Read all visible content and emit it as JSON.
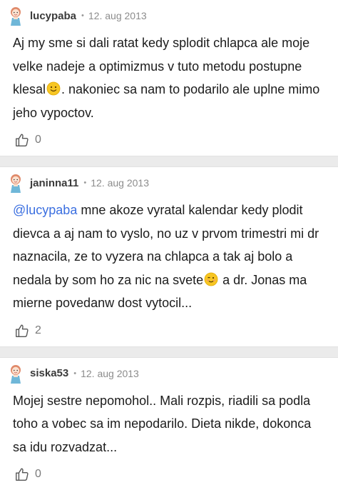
{
  "comments": [
    {
      "username": "lucypaba",
      "separator": "•",
      "date": "12. aug 2013",
      "text_a": "Aj my sme si dali ratat kedy splodit chlapca ale moje velke nadeje a optimizmus v tuto metodu postupne klesal",
      "emoji": "smiley",
      "text_b": ". nakoniec sa nam to podarilo ale uplne mimo jeho vypoctov.",
      "likes": "0"
    },
    {
      "username": "janinna11",
      "separator": "•",
      "date": "12. aug 2013",
      "mention": "@lucypaba",
      "text_a": " mne akoze vyratal kalendar kedy plodit dievca a aj nam to vyslo, no uz v prvom trimestri mi dr naznacila, ze to vyzera na chlapca a tak aj bolo a nedala by som ho za nic na svete",
      "emoji": "winking-face",
      "text_b": " a dr. Jonas ma mierne povedanw dost vytocil...",
      "likes": "2"
    },
    {
      "username": "siska53",
      "separator": "•",
      "date": "12. aug 2013",
      "text_a": "Mojej sestre nepomohol.. Mali rozpis, riadili sa podla toho a vobec sa im nepodarilo. Dieta nikde, dokonca sa idu rozvadzat...",
      "likes": "0"
    }
  ],
  "icons": {
    "like": "thumbs-up-icon",
    "avatar": "girl-avatar-icon"
  },
  "colors": {
    "mention": "#3b6fe0",
    "separator_bg": "#ebebeb",
    "username": "#3a3a3a",
    "meta": "#8c8c8c"
  }
}
